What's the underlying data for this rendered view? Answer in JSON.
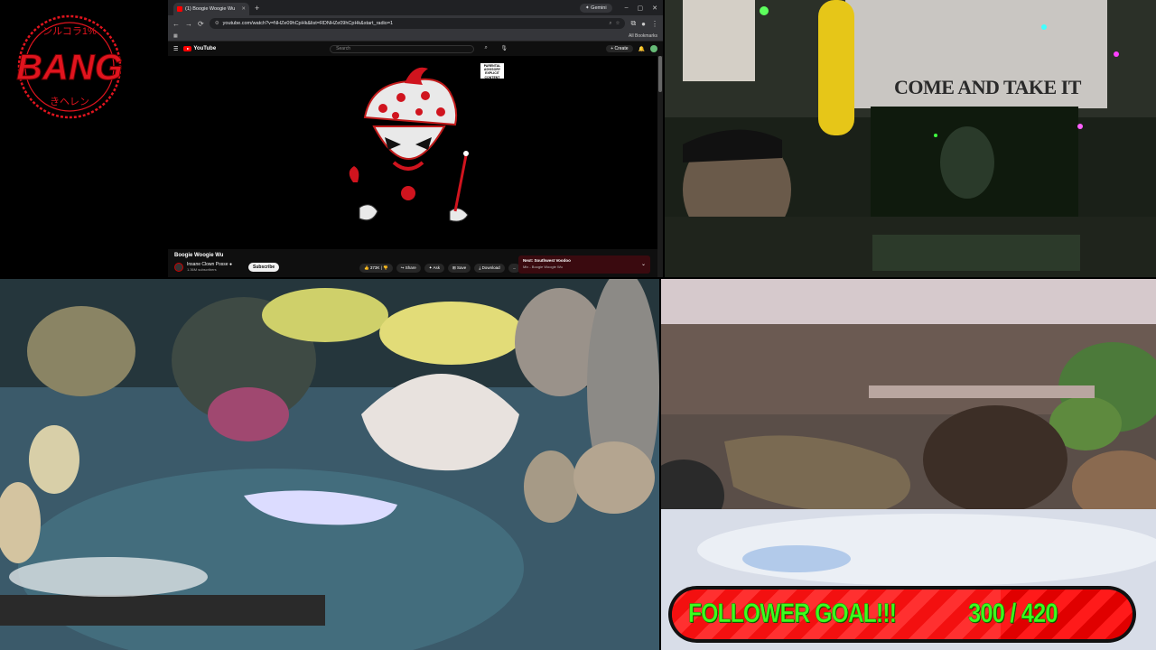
{
  "logo": {
    "text": "BANG",
    "top_text": "ンルコラ1%",
    "bottom_text": "きヘレン"
  },
  "browser": {
    "tab_title": "(1) Boogie Woogie Wu",
    "new_tab": "+",
    "gemini": "Gemini",
    "url": "youtube.com/watch?v=NHZe09hCpHk&list=RDNHZe09hCpHk&start_radio=1",
    "bookmarks": "All Bookmarks",
    "youtube": {
      "brand": "YouTube",
      "search_placeholder": "Search",
      "create": "+ Create",
      "advisory": "PARENTAL ADVISORY EXPLICIT CONTENT",
      "video_title": "Boogie Woogie Wu",
      "channel": "Insane Clown Posse ●",
      "subscribers": "1.36M subscribers",
      "subscribe": "Subscribe",
      "actions": {
        "likes": "373K",
        "share": "Share",
        "ask": "Ask",
        "save": "Save",
        "download": "Download",
        "more": "..."
      },
      "next_label": "Next: Southwest Voodoo",
      "next_sub": "Mix - Boogie Woogie Wu"
    }
  },
  "webcam": {
    "flag_text": "COME AND TAKE IT"
  },
  "goal": {
    "label": "FOLLOWER GOAL!!!",
    "current": 300,
    "target": 420,
    "count_text": "300 / 420"
  },
  "colors": {
    "goal_text": "#3cff1e",
    "goal_bar": "#ff1a1a",
    "youtube_red": "#ff0000"
  }
}
